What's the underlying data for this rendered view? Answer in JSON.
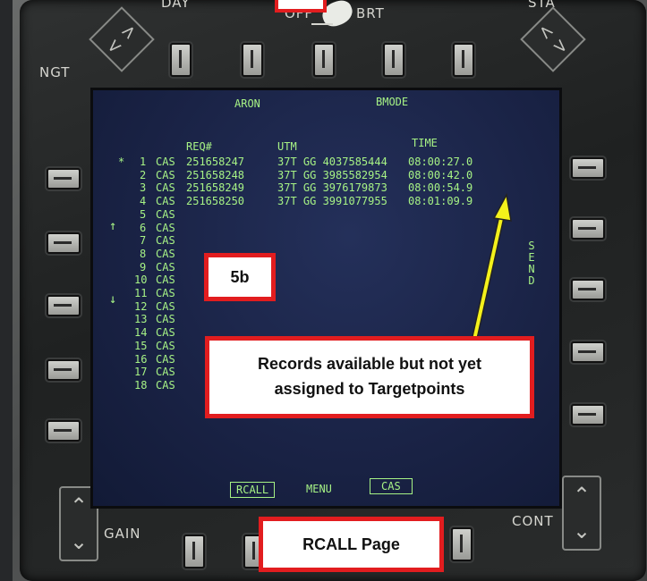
{
  "bezel": {
    "day_label": "DAY",
    "off_label": "OFF",
    "brt_label": "BRT",
    "ngt_label": "NGT",
    "gain_label": "GAIN",
    "cont_label": "CONT",
    "sta_label": "STA"
  },
  "screen": {
    "top_options": [
      "ARON",
      "BMODE"
    ],
    "headers": {
      "req": "REQ#",
      "utm": "UTM",
      "time": "TIME"
    },
    "rows": [
      {
        "marker": "*",
        "num": "1",
        "type": "CAS",
        "req": "251658247",
        "utm": "37T GG 4037585444",
        "time": "08:00:27.0"
      },
      {
        "marker": "",
        "num": "2",
        "type": "CAS",
        "req": "251658248",
        "utm": "37T GG 3985582954",
        "time": "08:00:42.0"
      },
      {
        "marker": "",
        "num": "3",
        "type": "CAS",
        "req": "251658249",
        "utm": "37T GG 3976179873",
        "time": "08:00:54.9"
      },
      {
        "marker": "",
        "num": "4",
        "type": "CAS",
        "req": "251658250",
        "utm": "37T GG 3991077955",
        "time": "08:01:09.9"
      },
      {
        "marker": "",
        "num": "5",
        "type": "CAS",
        "req": "",
        "utm": "",
        "time": ""
      },
      {
        "marker": "",
        "num": "6",
        "type": "CAS",
        "req": "",
        "utm": "",
        "time": ""
      },
      {
        "marker": "",
        "num": "7",
        "type": "CAS",
        "req": "",
        "utm": "",
        "time": ""
      },
      {
        "marker": "",
        "num": "8",
        "type": "CAS",
        "req": "",
        "utm": "",
        "time": ""
      },
      {
        "marker": "",
        "num": "9",
        "type": "CAS",
        "req": "",
        "utm": "",
        "time": ""
      },
      {
        "marker": "",
        "num": "10",
        "type": "CAS",
        "req": "",
        "utm": "",
        "time": ""
      },
      {
        "marker": "",
        "num": "11",
        "type": "CAS",
        "req": "",
        "utm": "",
        "time": ""
      },
      {
        "marker": "",
        "num": "12",
        "type": "CAS",
        "req": "",
        "utm": "",
        "time": ""
      },
      {
        "marker": "",
        "num": "13",
        "type": "CAS",
        "req": "",
        "utm": "",
        "time": ""
      },
      {
        "marker": "",
        "num": "14",
        "type": "CAS",
        "req": "",
        "utm": "",
        "time": ""
      },
      {
        "marker": "",
        "num": "15",
        "type": "CAS",
        "req": "",
        "utm": "",
        "time": ""
      },
      {
        "marker": "",
        "num": "16",
        "type": "CAS",
        "req": "",
        "utm": "",
        "time": ""
      },
      {
        "marker": "",
        "num": "17",
        "type": "CAS",
        "req": "",
        "utm": "",
        "time": ""
      },
      {
        "marker": "",
        "num": "18",
        "type": "CAS",
        "req": "",
        "utm": "",
        "time": ""
      }
    ],
    "scroll_up_icon": "up-arrow",
    "scroll_down_icon": "down-arrow",
    "send_label": "SEND",
    "bottom_options": {
      "rcall": "RCALL",
      "menu": "MENU",
      "cas": "CAS"
    }
  },
  "callouts": {
    "step": "5b",
    "records_note": "Records available but not yet assigned to Targetpoints",
    "page_label": "RCALL Page"
  },
  "colors": {
    "display_text": "#a6f285",
    "callout_border": "#e21d1f",
    "pointer_arrow": "#f4f11b"
  }
}
